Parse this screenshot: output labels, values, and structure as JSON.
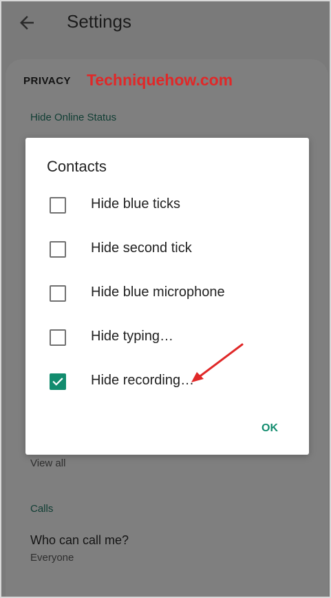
{
  "header": {
    "title": "Settings",
    "back_icon": "arrow-back-icon"
  },
  "privacy": {
    "title": "PRIVACY",
    "watermark": "Techniquehow.com"
  },
  "sections": {
    "hide_online_status": "Hide Online Status",
    "view_all": "View all",
    "calls": "Calls"
  },
  "calls": {
    "who_can_call": "Who can call me?",
    "who_can_call_value": "Everyone"
  },
  "dialog": {
    "title": "Contacts",
    "options": [
      {
        "label": "Hide blue ticks",
        "checked": false
      },
      {
        "label": "Hide second tick",
        "checked": false
      },
      {
        "label": "Hide blue microphone",
        "checked": false
      },
      {
        "label": "Hide typing…",
        "checked": false
      },
      {
        "label": "Hide recording…",
        "checked": true
      }
    ],
    "ok_label": "OK"
  },
  "colors": {
    "accent": "#128c6e",
    "section_label": "#0f3d33",
    "watermark": "#e02828",
    "annotation_arrow": "#e02828"
  }
}
